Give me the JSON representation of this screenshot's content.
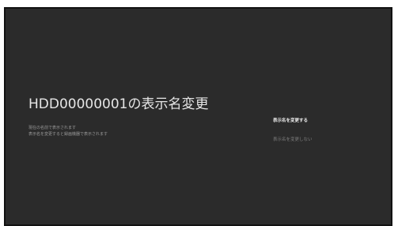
{
  "screen": {
    "title": "HDD00000001の表示名変更",
    "description": [
      "現在の名前で表示されます",
      "表示名を変更すると録画機器で表示されます"
    ],
    "options": [
      {
        "label": "表示名を変更する",
        "focused": true
      },
      {
        "label": "表示名を変更しない",
        "focused": false
      }
    ],
    "colors": {
      "background": "#2b2b2b",
      "title_text": "#e6e6e6",
      "focused_option": "#ececec",
      "unfocused_option": "#7d7d7d"
    }
  }
}
